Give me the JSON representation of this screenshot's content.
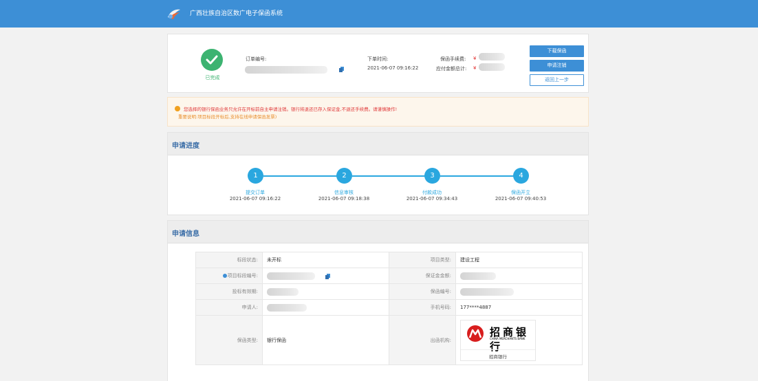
{
  "app": {
    "title": "广西壮族自治区数广电子保函系统"
  },
  "order": {
    "status": "已完成",
    "order_no_label": "订单编号:",
    "order_time_label": "下单时间:",
    "order_time": "2021-06-07 09:16:22",
    "fee_label": "保函手续费:",
    "total_label": "应付金额总计:",
    "currency": "¥",
    "buttons": {
      "download": "下载保函",
      "cancel": "申请注销",
      "back": "返回上一步"
    }
  },
  "notice": {
    "line1": "您选择的银行保函业务只允许在开标前自主申请注销。银行将退还已存入保证金,不退还手续费。请谨慎操作!",
    "line2": "重要说明:项目标段开标后,支持在线申请保函发票)"
  },
  "progress": {
    "title": "申请进度",
    "steps": [
      {
        "num": "1",
        "name": "提交订单",
        "time": "2021-06-07 09:16:22"
      },
      {
        "num": "2",
        "name": "信息审核",
        "time": "2021-06-07 09:18:38"
      },
      {
        "num": "3",
        "name": "付款成功",
        "time": "2021-06-07 09:34:43"
      },
      {
        "num": "4",
        "name": "保函开立",
        "time": "2021-06-07 09:40:53"
      }
    ]
  },
  "info": {
    "title": "申请信息",
    "rows": {
      "bid_status_label": "标段状态:",
      "bid_status": "未开标",
      "project_type_label": "项目类型:",
      "project_type": "建设工程",
      "section_no_label": "项目标段编号:",
      "deposit_label": "保证金金额:",
      "validity_label": "投标有效期:",
      "guarantee_no_label": "保函编号:",
      "applicant_label": "申请人:",
      "phone_label": "手机号码:",
      "phone": "177****4887",
      "guarantee_type_label": "保函类型:",
      "guarantee_type": "银行保函",
      "issuer_label": "出函机构:"
    },
    "bank": {
      "name_cn": "招商银行",
      "name_en": "CHINA MERCHANTS BANK",
      "caption": "招商银行"
    }
  },
  "colors": {
    "primary": "#3d8fd6",
    "success": "#3cb371",
    "step": "#2aa7df",
    "warning": "#f0a020",
    "danger": "#e03a3a"
  }
}
